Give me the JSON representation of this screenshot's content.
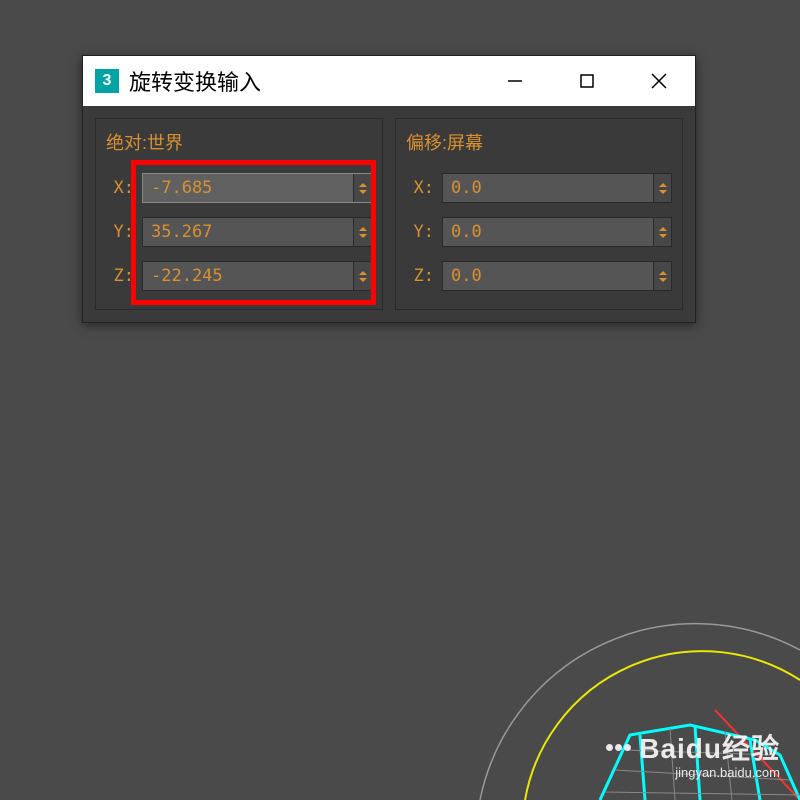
{
  "window": {
    "title": "旋转变换输入"
  },
  "panels": {
    "absolute": {
      "title": "绝对:世界",
      "x_label": "X:",
      "y_label": "Y:",
      "z_label": "Z:",
      "x_value": "-7.685",
      "y_value": "35.267",
      "z_value": "-22.245"
    },
    "offset": {
      "title": "偏移:屏幕",
      "x_label": "X:",
      "y_label": "Y:",
      "z_label": "Z:",
      "x_value": "0.0",
      "y_value": "0.0",
      "z_value": "0.0"
    }
  },
  "watermark": {
    "main": "Baidu经验",
    "sub": "jingyan.baidu.com"
  },
  "colors": {
    "accent": "#d89030",
    "highlight": "#ff0000",
    "background": "#4a4a4a",
    "panel": "#3a3a3a"
  }
}
